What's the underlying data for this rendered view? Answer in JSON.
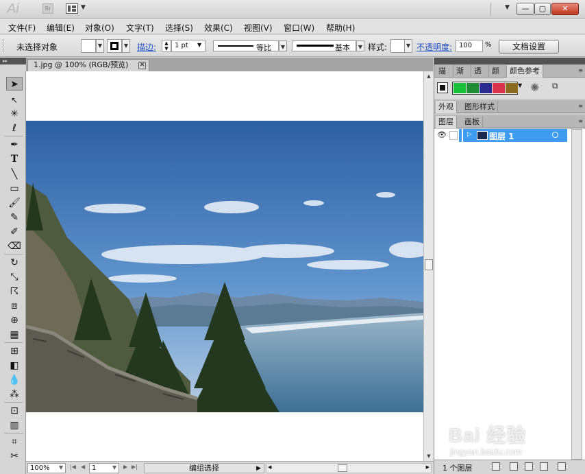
{
  "app": {
    "logo": "Ai",
    "bridge_label": "Br"
  },
  "window_controls": {
    "minimize": "—",
    "maximize": "▢",
    "close": "✕"
  },
  "menu": [
    "文件(F)",
    "编辑(E)",
    "对象(O)",
    "文字(T)",
    "选择(S)",
    "效果(C)",
    "视图(V)",
    "窗口(W)",
    "帮助(H)"
  ],
  "control_bar": {
    "selection_status": "未选择对象",
    "stroke_label": "描边:",
    "stroke_weight": "1 pt",
    "stroke_profile": "等比",
    "brush_label": "基本",
    "style_label": "样式:",
    "opacity_label": "不透明度:",
    "opacity_value": "100",
    "opacity_unit": "%",
    "doc_setup_button": "文档设置"
  },
  "document": {
    "tab_title": "1.jpg @ 100% (RGB/预览)",
    "tab_close": "✕"
  },
  "status_bar": {
    "zoom": "100%",
    "artboard_number": "1",
    "tool_status": "编组选择"
  },
  "panels": {
    "group1_tabs": [
      "描边",
      "渐变",
      "透明",
      "颜色",
      "颜色参考"
    ],
    "group2_tabs": [
      "外观",
      "图形样式"
    ],
    "group3_tabs": [
      "图层",
      "画板"
    ],
    "layer_name": "图层 1",
    "layer_count": "1 个图层"
  },
  "color_guide_swatches": [
    "#111111",
    "#19c13a",
    "#1e8d35",
    "#2a2b8c",
    "#d9344c",
    "#8b6b22"
  ],
  "watermark": {
    "brand": "Bai 经验",
    "url": "jingyan.baidu.com"
  }
}
